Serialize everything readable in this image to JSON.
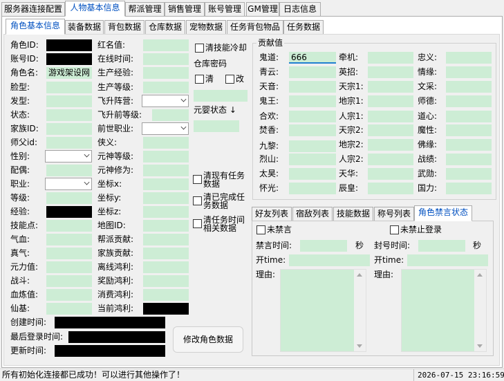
{
  "top_tabs": [
    "服务器连接配置",
    "人物基本信息",
    "帮派管理",
    "销售管理",
    "账号管理",
    "GM管理",
    "日志信息"
  ],
  "sub_tabs": [
    "角色基本信息",
    "装备数据",
    "背包数据",
    "仓库数据",
    "宠物数据",
    "任务背包物品",
    "任务数据"
  ],
  "col1": {
    "labels": [
      "角色ID:",
      "账号ID:",
      "角色名:",
      "脸型:",
      "发型:",
      "状态:",
      "家族ID:",
      "师父id:",
      "性别:",
      "配偶:",
      "职业:",
      "等级:",
      "经验:",
      "技能点:",
      "气血:",
      "真气:",
      "元力值:",
      "战斗:",
      "血炼值:",
      "仙基:"
    ],
    "role_name": "游戏架设网"
  },
  "col2": {
    "labels": [
      "红名值:",
      "在线时间:",
      "生产经验:",
      "生产等级:",
      "飞升阵营:",
      "飞升前等级:",
      "前世职业:",
      "侠义:",
      "元神等级:",
      "元神修为:",
      "坐标x:",
      "坐标y:",
      "坐标z:",
      "地图ID:",
      "帮派贡献:",
      "家族贡献:",
      "离线鸿利:",
      "奖励鸿利:",
      "消费鸿利:",
      "当前鸿利:"
    ]
  },
  "misc": {
    "clear_skill_cd": "清技能冷却",
    "warehouse_pwd": "仓库密码",
    "clear": "清",
    "change": "改",
    "yuanying_state": "元婴状态",
    "clear_current_tasks": "清现有任务数据",
    "clear_completed_tasks": "清已完成任务数据",
    "clear_task_time": "清任务时间相关数据"
  },
  "times": {
    "created": "创建时间:",
    "last_login": "最后登录时间:",
    "updated": "更新时间:"
  },
  "modify_button": "修改角色数据",
  "contrib": {
    "title": "贡献值",
    "col1": [
      "鬼道:",
      "青云:",
      "天音:",
      "鬼王:",
      "合欢:",
      "焚香:",
      "九黎:",
      "烈山:",
      "太昊:",
      "怀光:"
    ],
    "guidao_value": "666",
    "col2": [
      "牵机:",
      "英招:",
      "天宗1:",
      "地宗1:",
      "人宗1:",
      "天宗2:",
      "地宗2:",
      "人宗2:",
      "天华:",
      "辰皇:"
    ],
    "col3": [
      "忠义:",
      "情缘:",
      "文采:",
      "师德:",
      "道心:",
      "魔性:",
      "佛缘:",
      "战绩:",
      "武勋:",
      "国力:"
    ]
  },
  "lower_tabs": [
    "好友列表",
    "宿敌列表",
    "技能数据",
    "称号列表",
    "角色禁言状态"
  ],
  "ban": {
    "no_mute": "未禁言",
    "no_login_ban": "未禁止登录",
    "mute_time": "禁言时间:",
    "login_ban_time": "封号时间:",
    "sec": "秒",
    "open_time": "开time:",
    "reason": "理由:"
  },
  "status_text": "所有初始化连接都已成功！可以进行其他操作了！",
  "datetime": "2026-07-15 23:16:59"
}
